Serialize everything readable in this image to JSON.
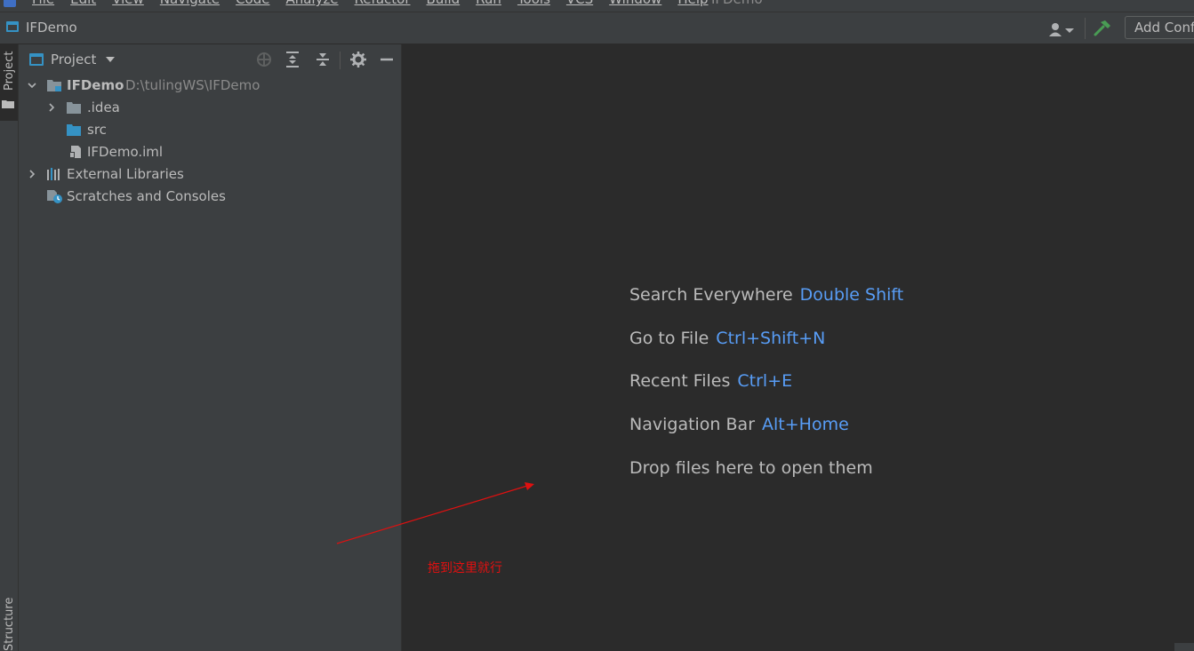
{
  "menubar": {
    "items": [
      "File",
      "Edit",
      "View",
      "Navigate",
      "Code",
      "Analyze",
      "Refactor",
      "Build",
      "Run",
      "Tools",
      "VCS",
      "Window",
      "Help"
    ],
    "window_title": "IFDemo"
  },
  "navbar": {
    "breadcrumb": "IFDemo",
    "add_configuration_label": "Add Configuration..."
  },
  "left_strip": {
    "project_label": "Project",
    "structure_label": "Structure"
  },
  "project_panel": {
    "title": "Project",
    "tree": [
      {
        "label": "IFDemo",
        "path": "D:\\tulingWS\\IFDemo"
      },
      {
        "label": ".idea"
      },
      {
        "label": "src"
      },
      {
        "label": "IFDemo.iml"
      },
      {
        "label": "External Libraries"
      },
      {
        "label": "Scratches and Consoles"
      }
    ]
  },
  "editor": {
    "hints": [
      {
        "label": "Search Everywhere",
        "shortcut": "Double Shift"
      },
      {
        "label": "Go to File",
        "shortcut": "Ctrl+Shift+N"
      },
      {
        "label": "Recent Files",
        "shortcut": "Ctrl+E"
      },
      {
        "label": "Navigation Bar",
        "shortcut": "Alt+Home"
      },
      {
        "label": "Drop files here to open them",
        "shortcut": ""
      }
    ]
  },
  "annotation": {
    "text": "拖到这里就行",
    "color": "#e01010"
  },
  "colors": {
    "background": "#2b2b2b",
    "panel": "#3c3f41",
    "text": "#bbbbbb",
    "shortcut": "#589df6",
    "folder_blue": "#3592c4"
  }
}
